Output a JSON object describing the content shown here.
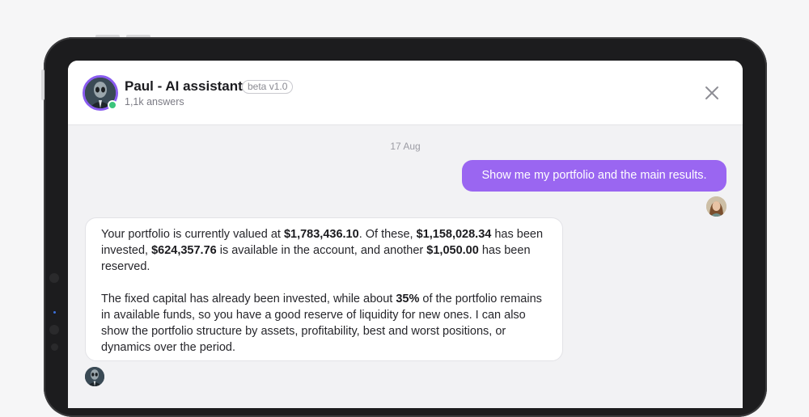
{
  "header": {
    "title": "Paul - AI assistant",
    "badge": "beta v1.0",
    "subtitle": "1,1k answers"
  },
  "chat": {
    "date": "17 Aug",
    "user_message": "Show me my portfolio and the main results.",
    "bot_message": {
      "p1": {
        "t1": "Your portfolio is currently valued at ",
        "b1": "$1,783,436.10",
        "t2": ". Of these, ",
        "b2": "$1,158,028.34",
        "t3": " has been invested, ",
        "b3": "$624,357.76",
        "t4": " is available in the account, and another ",
        "b4": "$1,050.00",
        "t5": " has been reserved."
      },
      "p2": {
        "t1": "The fixed capital has already been invested, while about ",
        "b1": "35%",
        "t2": " of the portfolio remains in available funds, so you have a good reserve of liquidity for new ones. I can also show the portfolio structure by assets, profitability, best and worst positions, or dynamics over the period."
      }
    }
  },
  "colors": {
    "accent": "#9a66f1",
    "avatar_ring": "#8a5cf0",
    "online": "#3cc47c"
  },
  "icons": {
    "close": "close-icon",
    "assistant_avatar": "alien-avatar",
    "user_avatar": "user-avatar"
  }
}
